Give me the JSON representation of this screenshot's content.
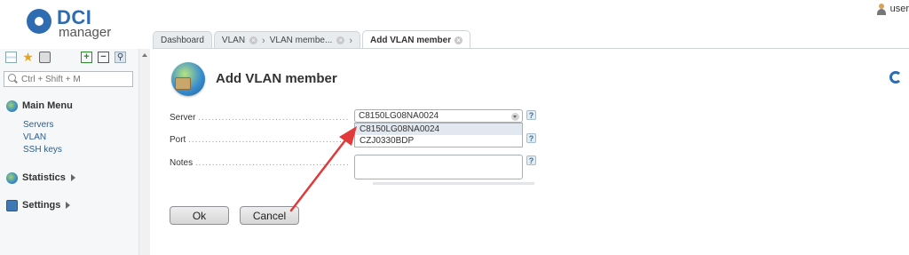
{
  "header": {
    "logo_dci": "DCI",
    "logo_manager": "manager",
    "user": {
      "icon": "user-icon",
      "name": "user"
    }
  },
  "tabs": [
    {
      "label": "Dashboard"
    },
    {
      "label": "VLAN"
    },
    {
      "label": "VLAN membe..."
    },
    {
      "label": "Add VLAN member"
    }
  ],
  "sidebar": {
    "toolbar_icons": [
      "tree-icon",
      "star-icon",
      "briefcase-icon",
      "expand-all-icon",
      "collapse-all-icon",
      "pin-icon"
    ],
    "search": {
      "placeholder": "Ctrl + Shift + M",
      "value": ""
    },
    "main_menu": {
      "label": "Main Menu",
      "items": [
        {
          "label": "Servers"
        },
        {
          "label": "VLAN"
        },
        {
          "label": "SSH keys"
        }
      ]
    },
    "statistics": {
      "label": "Statistics"
    },
    "settings": {
      "label": "Settings"
    }
  },
  "form": {
    "title": "Add VLAN member",
    "fields": {
      "server": {
        "label": "Server",
        "value": "C8150LG08NA0024",
        "options": [
          "C8150LG08NA0024",
          "CZJ0330BDP"
        ]
      },
      "port": {
        "label": "Port"
      },
      "notes": {
        "label": "Notes",
        "value": ""
      }
    },
    "help_glyph": "?",
    "buttons": {
      "ok": "Ok",
      "cancel": "Cancel"
    }
  },
  "colors": {
    "accent": "#2f6bb0",
    "link": "#2d5d8c",
    "annotation_arrow": "#e03a3a"
  }
}
